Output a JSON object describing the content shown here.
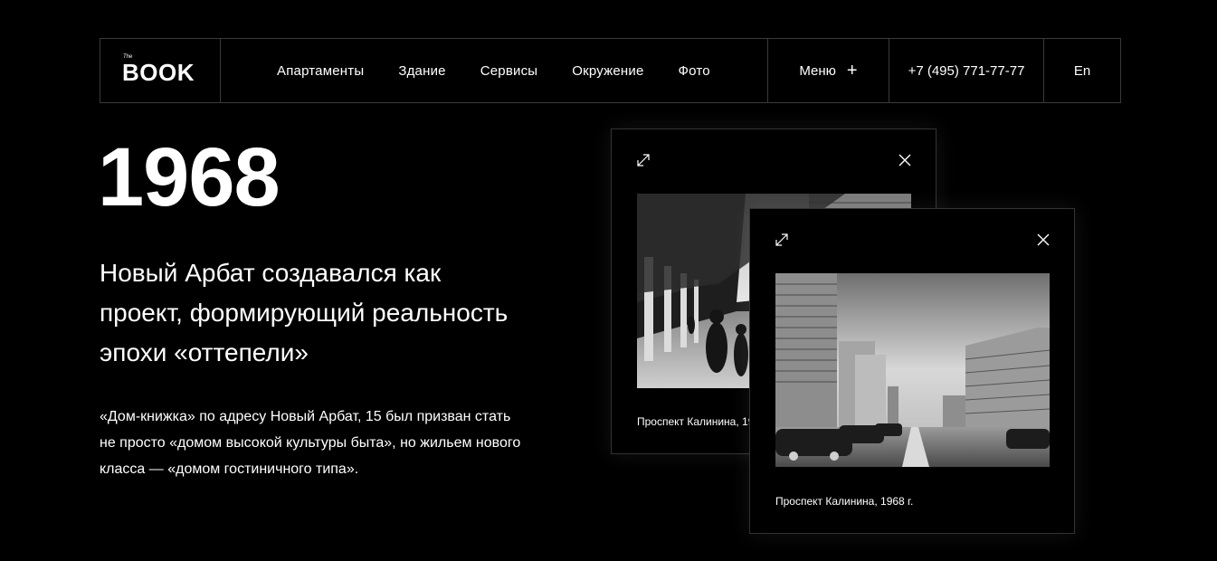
{
  "header": {
    "logo_small": "The",
    "logo_main": "BOOK",
    "nav": [
      "Апартаменты",
      "Здание",
      "Сервисы",
      "Окружение",
      "Фото"
    ],
    "menu_label": "Меню",
    "phone": "+7 (495) 771-77-77",
    "lang": "En"
  },
  "main": {
    "year": "1968",
    "lead": "Новый Арбат создавался как проект, формирующий реальность эпохи «оттепели»",
    "description": "«Дом-книжка» по адресу Новый Арбат, 15 был призван стать не просто «домом высокой культуры быта», но жильем нового класса — «домом гостиничного типа»."
  },
  "cards": [
    {
      "caption": "Проспект Калинина, 1968 г."
    },
    {
      "caption": "Проспект Калинина, 1968 г."
    }
  ],
  "icons": {
    "expand": "expand-icon",
    "close": "close-icon",
    "plus": "plus-icon"
  }
}
